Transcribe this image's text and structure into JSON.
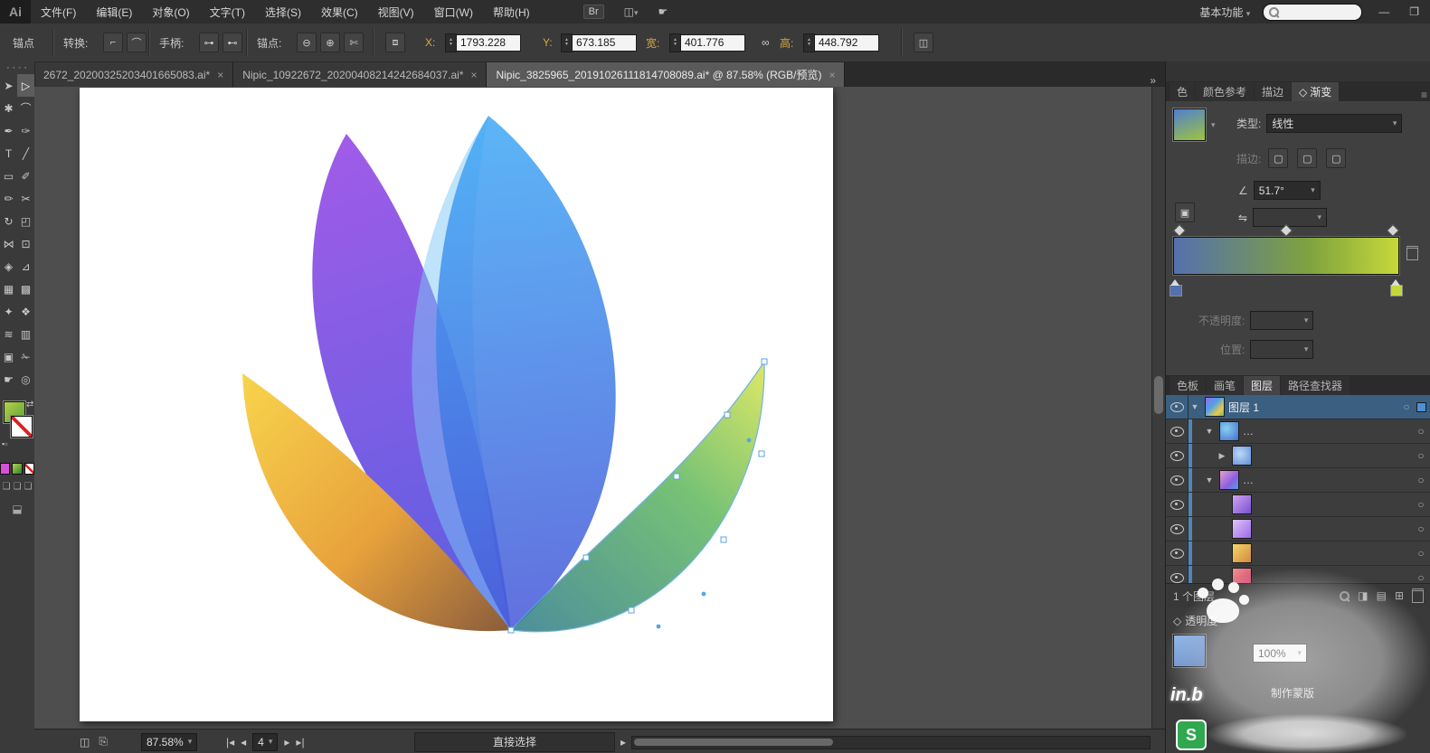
{
  "window": {
    "logo": "Ai",
    "workspace": "基本功能"
  },
  "menu": {
    "items": [
      "文件(F)",
      "编辑(E)",
      "对象(O)",
      "文字(T)",
      "选择(S)",
      "效果(C)",
      "视图(V)",
      "窗口(W)",
      "帮助(H)"
    ],
    "br_label": "Br"
  },
  "icons": {
    "arrange": "◫",
    "cslive": "☛",
    "minimize": "—",
    "restore": "❐",
    "caret_down": "▾",
    "convert_corner": "⌐",
    "convert_smooth": "⌒",
    "handles_show": "⊶",
    "handles_hide": "⊷",
    "anchor_add": "⊕",
    "anchor_remove": "⊖",
    "anchor_cut": "✄",
    "isolate": "⧈",
    "link": "∞",
    "transform": "◫",
    "close": "×",
    "tab_overflow": "»",
    "panel_menu": "≡",
    "gradient_diamond": "◇",
    "reverse": "⇋",
    "angle": "∠",
    "stroke_btn": "▢",
    "grip": "▪ ▪ ▪ ▪",
    "swap": "⇄",
    "draw_mode": "❏",
    "screen_mode": "⬓",
    "doc_icon_1": "◫",
    "doc_icon_2": "⎘",
    "nav_first": "|◂",
    "nav_prev": "◂",
    "nav_next": "▸",
    "nav_last": "▸|",
    "status_arrow": "▸",
    "target": "○",
    "clip_mask": "◨",
    "new_sublayer": "▤",
    "new_layer": "⊞"
  },
  "control_bar": {
    "context": "锚点",
    "convert_label": "转换:",
    "handles_label": "手柄:",
    "anchor_label": "锚点:",
    "x_label": "X:",
    "x_value": "1793.228",
    "y_label": "Y:",
    "y_value": "673.185",
    "width_label": "宽:",
    "width_value": "401.776",
    "height_label": "高:",
    "height_value": "448.792"
  },
  "doc_tabs": {
    "items": [
      {
        "label": "2672_20200325203401665083.ai*"
      },
      {
        "label": "Nipic_10922672_20200408214242684037.ai*"
      },
      {
        "label": "Nipic_3825965_20191026111814708089.ai* @ 87.58% (RGB/预览)"
      }
    ]
  },
  "toolbar": {
    "tools": [
      {
        "name": "selection-tool",
        "glyph": "➤"
      },
      {
        "name": "direct-selection-tool",
        "glyph": "▷"
      },
      {
        "name": "magic-wand-tool",
        "glyph": "✱"
      },
      {
        "name": "lasso-tool",
        "glyph": "⌒"
      },
      {
        "name": "pen-tool",
        "glyph": "✒"
      },
      {
        "name": "add-anchor-point-tool",
        "glyph": "✑"
      },
      {
        "name": "type-tool",
        "glyph": "T"
      },
      {
        "name": "line-segment-tool",
        "glyph": "╱"
      },
      {
        "name": "rectangle-tool",
        "glyph": "▭"
      },
      {
        "name": "paintbrush-tool",
        "glyph": "✐"
      },
      {
        "name": "pencil-tool",
        "glyph": "✏"
      },
      {
        "name": "scissors-tool",
        "glyph": "✂"
      },
      {
        "name": "rotate-tool",
        "glyph": "↻"
      },
      {
        "name": "scale-tool",
        "glyph": "◰"
      },
      {
        "name": "width-tool",
        "glyph": "⋈"
      },
      {
        "name": "free-transform-tool",
        "glyph": "⊡"
      },
      {
        "name": "shape-builder-tool",
        "glyph": "◈"
      },
      {
        "name": "perspective-grid-tool",
        "glyph": "⊿"
      },
      {
        "name": "mesh-tool",
        "glyph": "▦"
      },
      {
        "name": "gradient-tool",
        "glyph": "▩"
      },
      {
        "name": "eyedropper-tool",
        "glyph": "✦"
      },
      {
        "name": "blend-tool",
        "glyph": "❖"
      },
      {
        "name": "symbol-sprayer-tool",
        "glyph": "≋"
      },
      {
        "name": "column-graph-tool",
        "glyph": "▥"
      },
      {
        "name": "artboard-tool",
        "glyph": "▣"
      },
      {
        "name": "slice-tool",
        "glyph": "✁"
      },
      {
        "name": "hand-tool",
        "glyph": "☛"
      },
      {
        "name": "zoom-tool",
        "glyph": "◎"
      }
    ],
    "fill_style": "background:linear-gradient(135deg,#b5d24a,#5f9e3a)",
    "color_btn_style": "background:#d94fd9",
    "gradient_btn_style": "background:linear-gradient(135deg,#b5d24a,#2e7d32)"
  },
  "artwork": {
    "purple_from": "#a05ce8",
    "purple_to": "#5a5fe0",
    "blue_from": "#3fa9f5",
    "blue_to": "#4656d8",
    "lightblue": "#7ec8f5",
    "yellow_from": "#f8d44c",
    "yellow_mid": "#e8a23c",
    "yellow_to": "#8a5c3c",
    "green_tip": "#d9e44c",
    "green_mid": "#5fb85e",
    "green_base": "#2e7b8a",
    "selection": "#58a6e0"
  },
  "panels": {
    "top_tabs": [
      "色",
      "颜色参考",
      "描边",
      "渐变"
    ],
    "gradient": {
      "type_label": "类型:",
      "type_value": "线性",
      "stroke_label": "描边:",
      "angle_value": "51.7°",
      "opacity_label": "不透明度:",
      "position_label": "位置:",
      "thumb_style": "background:linear-gradient(160deg,#4f7fd0,#9ec43e)",
      "ramp_style": "background:linear-gradient(90deg,#5570ae 0%,#7ea23f 60%,#c6d839 100%)",
      "stop_left_style": "background:#5570ae",
      "stop_right_style": "background:#c6d839"
    },
    "mid_tabs": [
      "色板",
      "画笔",
      "图层",
      "路径查找器"
    ],
    "layers": {
      "rows": [
        {
          "expander": "▼",
          "label": "图层 1",
          "thumb_style": "background:linear-gradient(135deg,#9a6ae8 0%,#4fa0e8 40%,#ecc94b 75%,#63c06a 100%)"
        },
        {
          "expander": "▼",
          "label": "…",
          "thumb_style": "background:radial-gradient(circle at 35% 35%,#8ad0f0,#3f6fd0)"
        },
        {
          "expander": "▶",
          "label": "",
          "thumb_style": "background:radial-gradient(circle at 40% 40%,#bcd8f5,#5f8fd8)"
        },
        {
          "expander": "▼",
          "label": "…",
          "thumb_style": "background:linear-gradient(135deg,#e8a0d0,#8a5fe0 60%,#4fa0e8)"
        },
        {
          "expander": "",
          "label": "",
          "thumb_style": "background:linear-gradient(135deg,#cfa6f2,#7a4fd0)"
        },
        {
          "expander": "",
          "label": "",
          "thumb_style": "background:linear-gradient(135deg,#e0c4f8,#9a6ae8)"
        },
        {
          "expander": "",
          "label": "",
          "thumb_style": "background:linear-gradient(135deg,#f6d668,#d08a3e)"
        },
        {
          "expander": "",
          "label": "",
          "thumb_style": "background:linear-gradient(135deg,#f29090,#d04870)"
        }
      ],
      "status": "1 个图层"
    },
    "transparency": {
      "title": "透明度",
      "opacity_value": "100%",
      "make_mask_label": "制作蒙版",
      "thumb_style": "background:linear-gradient(135deg,#8ab6e8,#4a6fb5)"
    }
  },
  "status_bar": {
    "zoom": "87.58%",
    "page": "4",
    "tool_name": "直接选择"
  },
  "watermark": {
    "badge": "S",
    "text": "in.b"
  }
}
